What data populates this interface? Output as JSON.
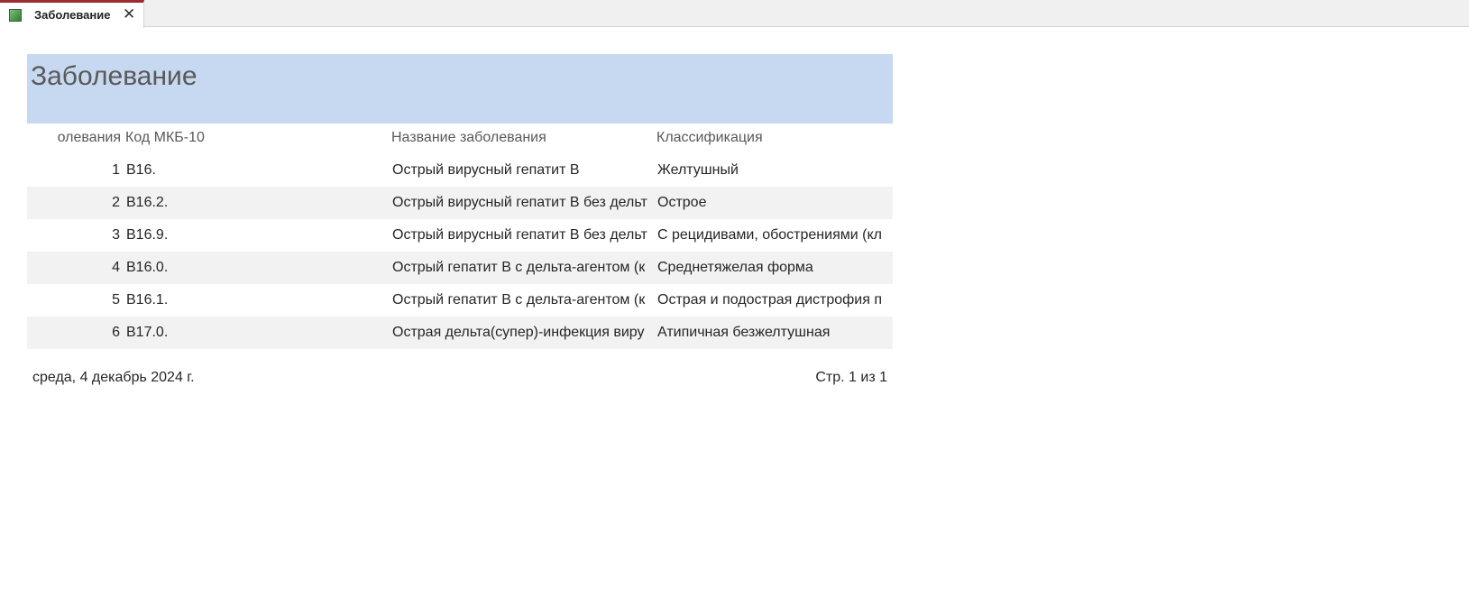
{
  "tab": {
    "label": "Заболевание",
    "icon": "report-icon",
    "close_icon": "close-icon"
  },
  "report": {
    "title": "Заболевание",
    "columns": {
      "num": "олевания",
      "code": "Код МКБ-10",
      "name": "Название заболевания",
      "classification": "Классификация"
    },
    "rows": [
      {
        "num": "1",
        "code": "B16.",
        "name": "Острый вирусный гепатит В",
        "classification": "Желтушный"
      },
      {
        "num": "2",
        "code": "B16.2.",
        "name": "Острый вирусный гепатит В без дельт",
        "classification": "Острое"
      },
      {
        "num": "3",
        "code": "B16.9.",
        "name": "Острый вирусный гепатит В без дельт",
        "classification": "С рецидивами, обострениями (кл"
      },
      {
        "num": "4",
        "code": "B16.0.",
        "name": "Острый гепатит В с дельта-агентом (к",
        "classification": "Среднетяжелая форма"
      },
      {
        "num": "5",
        "code": "B16.1.",
        "name": "Острый гепатит В с дельта-агентом (к",
        "classification": "Острая и подострая дистрофия п"
      },
      {
        "num": "6",
        "code": "B17.0.",
        "name": " Острая дельта(супер)-инфекция виру",
        "classification": "Атипичная безжелтушная"
      }
    ],
    "footer": {
      "date": "среда, 4 декабрь 2024 г.",
      "page": "Стр. 1 из 1"
    }
  },
  "colors": {
    "header_band": "#c6d9f0",
    "tab_accent": "#9b2d30",
    "alt_row": "#f2f2f2"
  }
}
